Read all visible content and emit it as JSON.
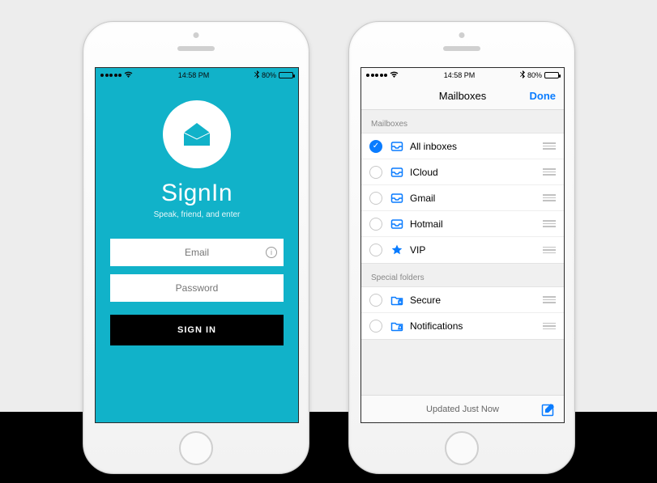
{
  "statusbar": {
    "time": "14:58 PM",
    "battery_pct": "80%"
  },
  "signin": {
    "title": "SignIn",
    "subtitle": "Speak, friend, and enter",
    "email_placeholder": "Email",
    "password_placeholder": "Password",
    "button_label": "SIGN IN"
  },
  "mail": {
    "nav_title": "Mailboxes",
    "nav_done": "Done",
    "section_mailboxes": "Mailboxes",
    "section_special": "Special folders",
    "toolbar_status": "Updated Just Now",
    "mailboxes": [
      {
        "label": "All inboxes",
        "checked": true,
        "icon": "tray"
      },
      {
        "label": "ICloud",
        "checked": false,
        "icon": "tray"
      },
      {
        "label": "Gmail",
        "checked": false,
        "icon": "tray"
      },
      {
        "label": "Hotmail",
        "checked": false,
        "icon": "tray"
      },
      {
        "label": "VIP",
        "checked": false,
        "icon": "star"
      }
    ],
    "special": [
      {
        "label": "Secure",
        "checked": false,
        "icon": "folder-lock"
      },
      {
        "label": "Notifications",
        "checked": false,
        "icon": "folder-bell"
      }
    ]
  }
}
